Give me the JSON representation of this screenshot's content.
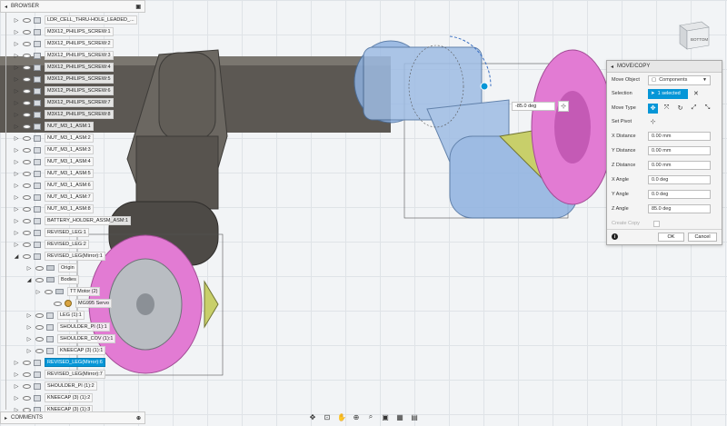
{
  "browser": {
    "title": "BROWSER",
    "items": [
      {
        "label": "LDR_CELL_THRU-HOLE_LEADED_...",
        "top": 0
      },
      {
        "label": "M3X12_PHILIPS_SCREW:1"
      },
      {
        "label": "M3X12_PHILIPS_SCREW:2"
      },
      {
        "label": "M3X12_PHILIPS_SCREW:3"
      },
      {
        "label": "M3X12_PHILIPS_SCREW:4"
      },
      {
        "label": "M3X12_PHILIPS_SCREW:5"
      },
      {
        "label": "M3X12_PHILIPS_SCREW:6"
      },
      {
        "label": "M3X12_PHILIPS_SCREW:7"
      },
      {
        "label": "M3X12_PHILIPS_SCREW:8"
      },
      {
        "label": "NUT_M3_1_ASM:1"
      },
      {
        "label": "NUT_M3_1_ASM:2"
      },
      {
        "label": "NUT_M3_1_ASM:3"
      },
      {
        "label": "NUT_M3_1_ASM:4"
      },
      {
        "label": "NUT_M3_1_ASM:5"
      },
      {
        "label": "NUT_M3_1_ASM:6"
      },
      {
        "label": "NUT_M3_1_ASM:7"
      },
      {
        "label": "NUT_M3_1_ASM:8"
      },
      {
        "label": "BATTERY_HOLDER_ASSM_ASM:1"
      },
      {
        "label": "REVISED_LEG:1"
      },
      {
        "label": "REVISED_LEG:2"
      },
      {
        "label": "REVISED_LEG(Mirror):1"
      },
      {
        "label": "Origin"
      },
      {
        "label": "Bodies"
      },
      {
        "label": "TT Motor (2)"
      },
      {
        "label": "MG995 Servo"
      },
      {
        "label": "LEG (1):1"
      },
      {
        "label": "SHOULDER_PI (1):1"
      },
      {
        "label": "SHOULDER_COV (1):1"
      },
      {
        "label": "KNEECAP (3) (1):1"
      },
      {
        "label": "REVISED_LEG(Mirror):6"
      },
      {
        "label": "REVISED_LEG(Mirror):7"
      },
      {
        "label": "SHOULDER_PI (1):2"
      },
      {
        "label": "KNEECAP (3) (1):2"
      },
      {
        "label": "KNEECAP (3) (1):3"
      }
    ]
  },
  "comments": {
    "title": "COMMENTS"
  },
  "viewcube": {
    "face": "BOTTOM"
  },
  "viewport": {
    "angle_value": "-85.0 deg"
  },
  "dialog": {
    "title": "MOVE/COPY",
    "move_object_label": "Move Object",
    "move_object_value": "Components",
    "selection_label": "Selection",
    "selection_value": "1 selected",
    "move_type_label": "Move Type",
    "set_pivot_label": "Set Pivot",
    "x_distance_label": "X Distance",
    "x_distance_value": "0.00 mm",
    "y_distance_label": "Y Distance",
    "y_distance_value": "0.00 mm",
    "z_distance_label": "Z Distance",
    "z_distance_value": "0.00 mm",
    "x_angle_label": "X Angle",
    "x_angle_value": "0.0 deg",
    "y_angle_label": "Y Angle",
    "y_angle_value": "0.0 deg",
    "z_angle_label": "Z Angle",
    "z_angle_value": "85.0 deg",
    "create_copy_label": "Create Copy",
    "ok_label": "OK",
    "cancel_label": "Cancel"
  },
  "colors": {
    "accent": "#0696d7",
    "tire": "#e27bd3",
    "hub": "#c9ccd0",
    "selected_body": "#8fb2e0",
    "motor": "#c8cf6a"
  }
}
